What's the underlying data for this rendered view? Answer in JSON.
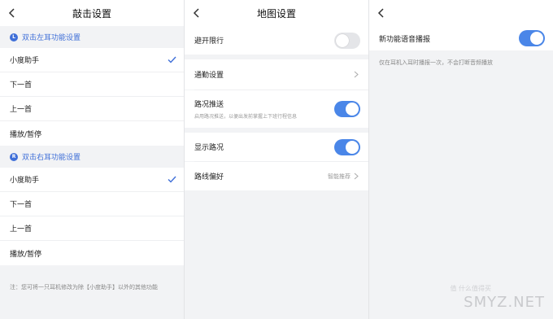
{
  "panel1": {
    "title": "敲击设置",
    "left_section": {
      "badge": "L",
      "label": "双击左耳功能设置"
    },
    "left_items": [
      {
        "label": "小度助手",
        "checked": true
      },
      {
        "label": "下一首",
        "checked": false
      },
      {
        "label": "上一首",
        "checked": false
      },
      {
        "label": "播放/暂停",
        "checked": false
      }
    ],
    "right_section": {
      "badge": "R",
      "label": "双击右耳功能设置"
    },
    "right_items": [
      {
        "label": "小度助手",
        "checked": true
      },
      {
        "label": "下一首",
        "checked": false
      },
      {
        "label": "上一首",
        "checked": false
      },
      {
        "label": "播放/暂停",
        "checked": false
      }
    ],
    "note": "注：您可将一只耳机修改为除【小度助手】以外的其他功能"
  },
  "panel2": {
    "title": "地图设置",
    "avoid_limit": {
      "label": "避开限行",
      "on": false
    },
    "commute": {
      "label": "通勤设置"
    },
    "traffic_push": {
      "label": "路况推送",
      "sub": "启用路况推送，以便出发前掌握上下班行程信息",
      "on": true
    },
    "show_traffic": {
      "label": "显示路况",
      "on": true
    },
    "route_pref": {
      "label": "路线偏好",
      "value": "智能推荐"
    }
  },
  "panel3": {
    "voice_broadcast": {
      "label": "新功能语音播报",
      "on": true
    },
    "hint": "仅在耳机入耳时播报一次，不会打断音频播放"
  },
  "watermark": {
    "text": "SMYZ.NET",
    "sub": "值 什么值得买"
  },
  "colors": {
    "accent": "#4a86e8",
    "background": "#f2f3f5"
  }
}
